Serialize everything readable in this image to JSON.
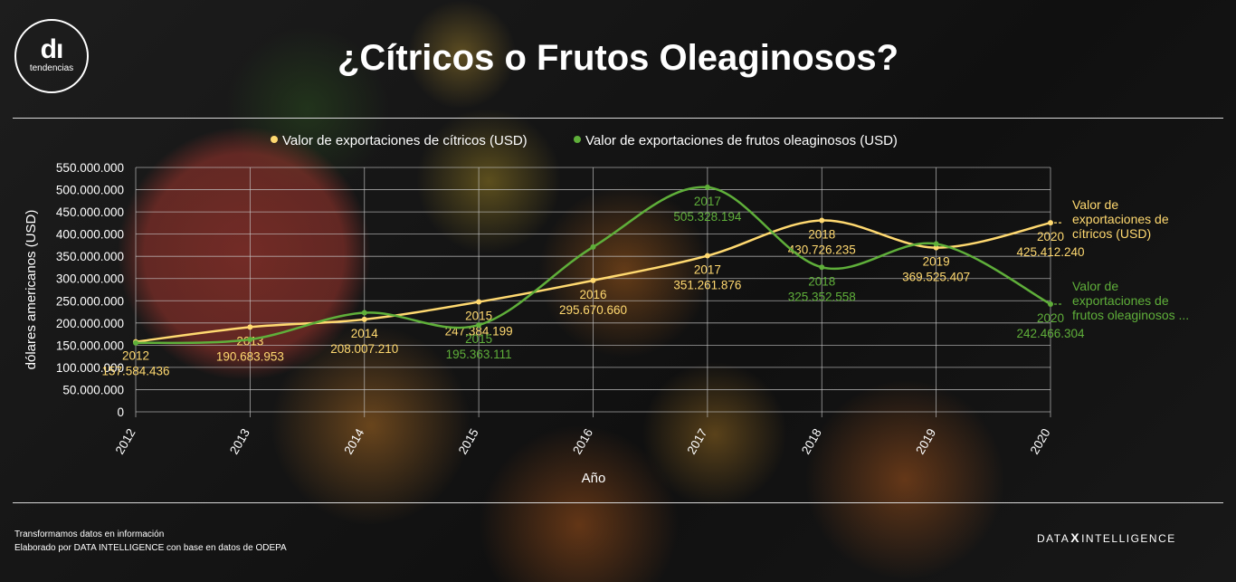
{
  "header": {
    "logo_mark": "dı",
    "logo_text": "tendencias",
    "title": "¿Cítricos o Frutos Oleaginosos?"
  },
  "footer": {
    "line1": "Transformamos datos en información",
    "line2": "Elaborado por DATA INTELLIGENCE con base en datos de ODEPA",
    "brand_left": "DATA",
    "brand_x": "X",
    "brand_right": "INTELLIGENCE"
  },
  "colors": {
    "citricos": "#ffd970",
    "oleaginosos": "#5faf3a",
    "text": "#ffffff",
    "grid": "#c8c8c8"
  },
  "chart_data": {
    "type": "line",
    "title": "",
    "xlabel": "Año",
    "ylabel": "dólares americanos (USD)",
    "x": [
      "2012",
      "2013",
      "2014",
      "2015",
      "2016",
      "2017",
      "2018",
      "2019",
      "2020"
    ],
    "ylim": [
      0,
      550000000
    ],
    "yticks": [
      "0",
      "50.000.000",
      "100.000.000",
      "150.000.000",
      "200.000.000",
      "250.000.000",
      "300.000.000",
      "350.000.000",
      "400.000.000",
      "450.000.000",
      "500.000.000",
      "550.000.000"
    ],
    "grid": true,
    "legend_position": "top",
    "series": [
      {
        "name": "Valor de exportaciones de cítricos (USD)",
        "end_label": [
          "Valor de",
          "exportaciones de",
          "cítricos (USD)"
        ],
        "values": [
          157584436,
          190683953,
          208007210,
          247384199,
          295670660,
          351261876,
          430726235,
          369525407,
          425412240
        ],
        "labels": [
          "157.584.436",
          "190.683.953",
          "208.007.210",
          "247.384.199",
          "295.670.660",
          "351.261.876",
          "430.726.235",
          "369.525.407",
          "425.412.240"
        ]
      },
      {
        "name": "Valor de exportaciones de frutos oleaginosos (USD)",
        "end_label": [
          "Valor de",
          "exportaciones de",
          "frutos oleaginosos ..."
        ],
        "values": [
          155000000,
          163000000,
          223000000,
          195363111,
          371000000,
          505328194,
          325352558,
          378000000,
          242466304
        ],
        "labels": [
          "",
          "",
          "",
          "195.363.111",
          "",
          "505.328.194",
          "325.352.558",
          "",
          "242.466.304"
        ]
      }
    ]
  }
}
